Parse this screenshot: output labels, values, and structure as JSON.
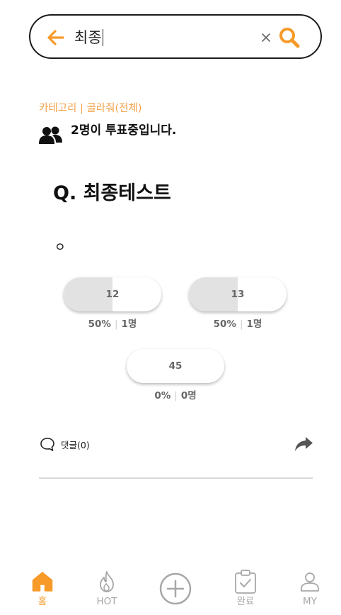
{
  "search": {
    "query": "최종"
  },
  "post": {
    "category": "카테고리 | 골라줘(전체)",
    "voters_text": "2명이 투표중입니다.",
    "question_title": "Q. 최종테스트",
    "question_body": "ㅇ"
  },
  "options": [
    {
      "label": "12",
      "percent": "50%",
      "count": "1명",
      "fill_fraction": 0.5
    },
    {
      "label": "13",
      "percent": "50%",
      "count": "1명",
      "fill_fraction": 0.5
    },
    {
      "label": "45",
      "percent": "0%",
      "count": "0명",
      "fill_fraction": 0
    }
  ],
  "comments": {
    "label": "댓글(0)"
  },
  "nav": {
    "home": "홈",
    "hot": "HOT",
    "done": "완료",
    "my": "MY",
    "active": "home"
  },
  "colors": {
    "accent": "#f79a2a",
    "category": "#f4a24a",
    "inactive": "#a7a7a7",
    "fill": "#e2e2e2"
  },
  "icons": {
    "back": "arrow-left-icon",
    "clear": "close-icon",
    "search": "search-icon",
    "voters": "users-icon",
    "comment": "speech-bubble-icon",
    "share": "share-icon",
    "home": "home-icon",
    "hot": "flame-icon",
    "add": "plus-circle-icon",
    "done": "clipboard-check-icon",
    "my": "user-icon"
  }
}
